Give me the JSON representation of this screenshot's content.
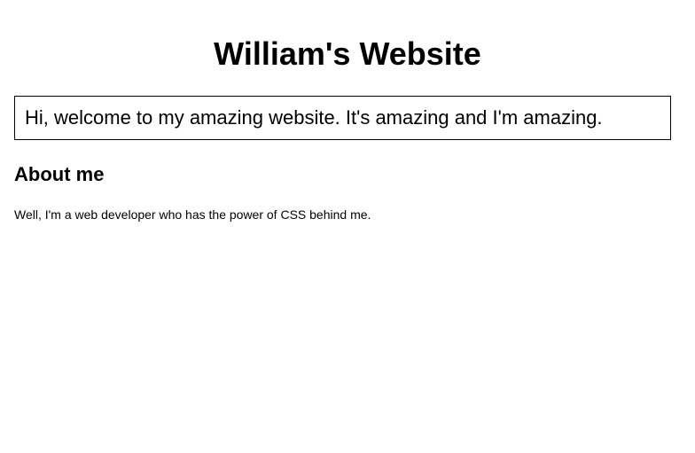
{
  "page_title": "William's Website",
  "welcome_box": "Hi, welcome to my amazing website. It's amazing and I'm amazing.",
  "about": {
    "heading": "About me",
    "text": "Well, I'm a web developer who has the power of CSS behind me."
  }
}
